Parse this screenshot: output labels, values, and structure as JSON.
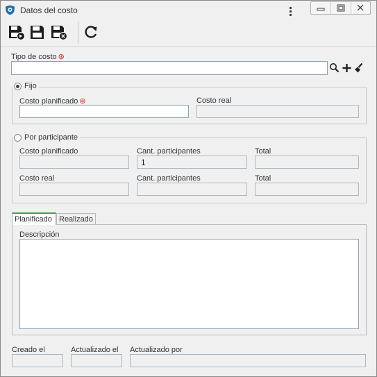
{
  "window": {
    "title": "Datos del costo",
    "icon": "app-shield-icon",
    "controls": [
      "minimize-icon",
      "restore-icon",
      "close-icon"
    ]
  },
  "toolbar": {
    "buttons": [
      {
        "name": "save-and-new",
        "icon": "save-new-icon"
      },
      {
        "name": "save",
        "icon": "save-icon"
      },
      {
        "name": "save-and-close",
        "icon": "save-close-icon"
      },
      {
        "name": "refresh",
        "icon": "refresh-icon"
      }
    ]
  },
  "tipo_costo": {
    "label": "Tipo de costo",
    "required": true,
    "value": "",
    "buttons": [
      "search-icon",
      "plus-icon",
      "clear-icon"
    ]
  },
  "fijo": {
    "legend": "Fijo",
    "selected": true,
    "costo_planificado_label": "Costo planificado",
    "costo_planificado_value": "",
    "costo_real_label": "Costo real",
    "costo_real_value": ""
  },
  "por_participante": {
    "legend": "Por participante",
    "selected": false,
    "row1": {
      "costo_planificado_label": "Costo planificado",
      "costo_planificado_value": "",
      "cant_label": "Cant. participantes",
      "cant_value": "1",
      "total_label": "Total",
      "total_value": ""
    },
    "row2": {
      "costo_real_label": "Costo real",
      "costo_real_value": "",
      "cant_label": "Cant. participantes",
      "cant_value": "",
      "total_label": "Total",
      "total_value": ""
    }
  },
  "tabs": {
    "items": [
      {
        "label": "Planificado",
        "active": true
      },
      {
        "label": "Realizado",
        "active": false
      }
    ],
    "descripcion_label": "Descripción",
    "descripcion_value": ""
  },
  "footer": {
    "creado_label": "Creado el",
    "creado_value": "",
    "actualizado_label": "Actualizado el",
    "actualizado_value": "",
    "actualizado_por_label": "Actualizado por",
    "actualizado_por_value": ""
  },
  "colors": {
    "required": "#d32f2f",
    "field_border": "#8fa3b8",
    "active_tab_accent": "#4a9f4a",
    "window_bg": "#f0f0f0"
  }
}
